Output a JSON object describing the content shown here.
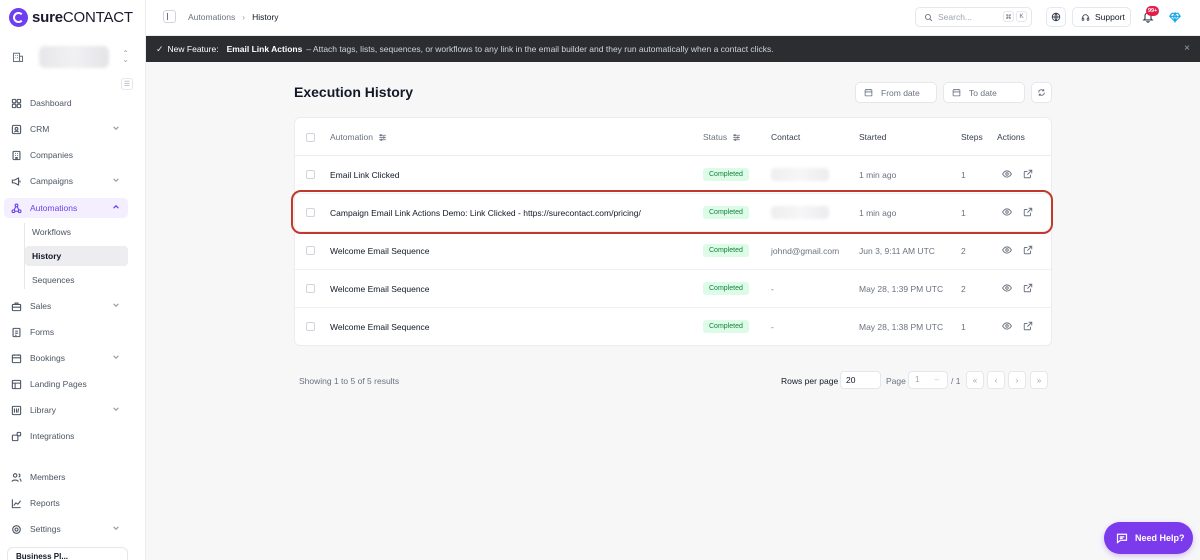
{
  "brand": {
    "name_bold": "sure",
    "name_rest": "CONTACT",
    "accent": "#6d3ff0"
  },
  "sidebar": {
    "nav": [
      {
        "label": "Dashboard",
        "icon": "dashboard-icon"
      },
      {
        "label": "CRM",
        "icon": "contact-card-icon",
        "has_children": true
      },
      {
        "label": "Companies",
        "icon": "building-icon"
      },
      {
        "label": "Campaigns",
        "icon": "megaphone-icon",
        "has_children": true
      },
      {
        "label": "Automations",
        "icon": "workflow-icon",
        "has_children": true,
        "active": true
      },
      {
        "label": "Sales",
        "icon": "briefcase-icon",
        "has_children": true
      },
      {
        "label": "Forms",
        "icon": "form-icon"
      },
      {
        "label": "Bookings",
        "icon": "calendar-icon",
        "has_children": true
      },
      {
        "label": "Landing Pages",
        "icon": "layout-icon"
      },
      {
        "label": "Library",
        "icon": "library-icon",
        "has_children": true
      },
      {
        "label": "Integrations",
        "icon": "puzzle-icon"
      },
      {
        "label": "Members",
        "icon": "users-icon"
      },
      {
        "label": "Reports",
        "icon": "chart-line-icon"
      },
      {
        "label": "Settings",
        "icon": "gear-icon",
        "has_children": true
      }
    ],
    "automations_sub": [
      "Workflows",
      "History",
      "Sequences"
    ],
    "selected_sub": "History",
    "bottom_card": "Business Pl..."
  },
  "topbar": {
    "breadcrumb": [
      "Automations",
      "History"
    ],
    "search_placeholder": "Search...",
    "shortcut": [
      "⌘",
      "K"
    ],
    "support_label": "Support",
    "notification_count": "99+"
  },
  "announcement": {
    "prefix": "New Feature:",
    "feature_name": "Email Link Actions",
    "text": "– Attach tags, lists, sequences, or workflows to any link in the email builder and they run automatically when a contact clicks."
  },
  "main": {
    "title": "Execution History",
    "from_date_placeholder": "From date",
    "to_date_placeholder": "To date",
    "columns": {
      "automation": "Automation",
      "status": "Status",
      "contact": "Contact",
      "started": "Started",
      "steps": "Steps",
      "actions": "Actions"
    },
    "rows": [
      {
        "automation": "Email Link Clicked",
        "status": "Completed",
        "contact": "",
        "contact_blurred": true,
        "started": "1 min ago",
        "steps": "1"
      },
      {
        "automation": "Campaign Email Link Actions Demo: Link Clicked - https://surecontact.com/pricing/",
        "status": "Completed",
        "contact": "",
        "contact_blurred": true,
        "started": "1 min ago",
        "steps": "1",
        "highlighted": true
      },
      {
        "automation": "Welcome Email Sequence",
        "status": "Completed",
        "contact": "johnd@gmail.com",
        "contact_blurred": false,
        "started": "Jun 3, 9:11 AM UTC",
        "steps": "2"
      },
      {
        "automation": "Welcome Email Sequence",
        "status": "Completed",
        "contact": "-",
        "contact_blurred": false,
        "started": "May 28, 1:39 PM UTC",
        "steps": "2"
      },
      {
        "automation": "Welcome Email Sequence",
        "status": "Completed",
        "contact": "-",
        "contact_blurred": false,
        "started": "May 28, 1:38 PM UTC",
        "steps": "1"
      }
    ],
    "pagination": {
      "info": "Showing 1 to 5 of 5 results",
      "rows_per_page_label": "Rows per page",
      "rows_per_page": "20",
      "page_label": "Page",
      "page": "1",
      "page_total": "/ 1",
      "buttons": [
        "«",
        "‹",
        "›",
        "»"
      ]
    }
  },
  "help_button": "Need Help?",
  "colors": {
    "status_bg": "#dcfce7",
    "status_text": "#15803d",
    "highlight": "#c0392b",
    "announce_bg": "#2b2d31"
  }
}
